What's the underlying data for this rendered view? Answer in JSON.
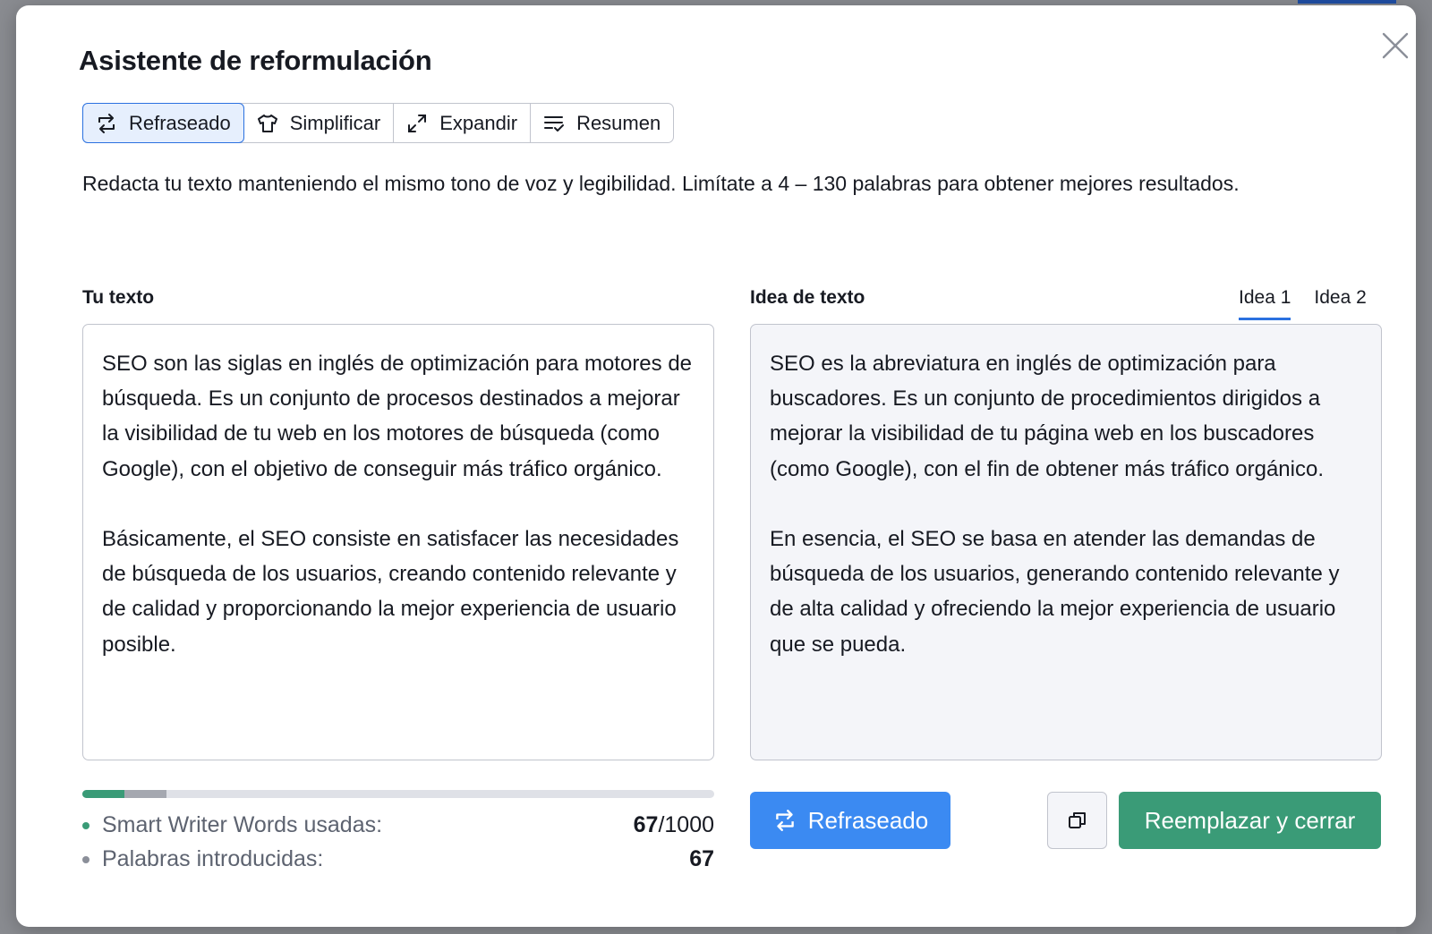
{
  "modal": {
    "title": "Asistente de reformulación",
    "close_icon": "close-icon"
  },
  "mode_tabs": [
    {
      "label": "Refraseado",
      "icon": "rephrase-icon",
      "active": true
    },
    {
      "label": "Simplificar",
      "icon": "shirt-icon",
      "active": false
    },
    {
      "label": "Expandir",
      "icon": "expand-icon",
      "active": false
    },
    {
      "label": "Resumen",
      "icon": "summary-icon",
      "active": false
    }
  ],
  "description": "Redacta tu texto manteniendo el mismo tono de voz y legibilidad. Limítate a 4 – 130 palabras para obtener mejores resultados.",
  "input_panel": {
    "label": "Tu texto",
    "paragraphs": [
      "SEO son las siglas en inglés de optimización para motores de búsqueda. Es un conjunto de procesos destinados a mejorar la visibilidad de tu web en los motores de búsqueda (como Google), con el objetivo de conseguir más tráfico orgánico.",
      "Básicamente, el SEO consiste en satisfacer las necesidades de búsqueda de los usuarios, creando contenido relevante y de calidad y proporcionando la mejor experiencia de usuario posible."
    ]
  },
  "output_panel": {
    "label": "Idea de texto",
    "tabs": [
      {
        "label": "Idea 1",
        "active": true
      },
      {
        "label": "Idea 2",
        "active": false
      }
    ],
    "paragraphs": [
      "SEO es la abreviatura en inglés de optimización para buscadores. Es un conjunto de procedimientos dirigidos a mejorar la visibilidad de tu página web en los buscadores (como Google), con el fin de obtener más tráfico orgánico.",
      "En esencia, el SEO se basa en atender las demandas de búsqueda de los usuarios, generando contenido relevante y de alta calidad y ofreciendo la mejor experiencia de usuario que se pueda."
    ]
  },
  "usage": {
    "words_used_label": "Smart Writer Words usadas:",
    "words_used": "67",
    "words_limit": "/1000",
    "words_entered_label": "Palabras introducidas:",
    "words_entered": "67",
    "used_fraction": 0.067,
    "entered_fraction": 0.067
  },
  "actions": {
    "rephrase_label": "Refraseado",
    "copy_icon": "copy-icon",
    "replace_label": "Reemplazar y cerrar"
  },
  "colors": {
    "accent_blue": "#3b8af2",
    "tab_active_border": "#2b71e0",
    "green": "#3a9b77",
    "gray_segment": "#a5a8b0"
  }
}
